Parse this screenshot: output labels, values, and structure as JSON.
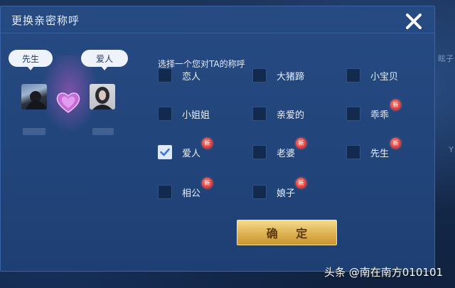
{
  "dialog": {
    "title": "更换亲密称呼",
    "prompt": "选择一个您对TA的称呼",
    "confirm_label": "确 定"
  },
  "pair": {
    "left_bubble": "先生",
    "right_bubble": "爱人"
  },
  "options": [
    {
      "label": "恋人",
      "checked": false,
      "is_new": false
    },
    {
      "label": "大猪蹄",
      "checked": false,
      "is_new": false
    },
    {
      "label": "小宝贝",
      "checked": false,
      "is_new": false
    },
    {
      "label": "小姐姐",
      "checked": false,
      "is_new": false
    },
    {
      "label": "亲爱的",
      "checked": false,
      "is_new": false
    },
    {
      "label": "乖乖",
      "checked": false,
      "is_new": true
    },
    {
      "label": "爱人",
      "checked": true,
      "is_new": true
    },
    {
      "label": "老婆",
      "checked": false,
      "is_new": true
    },
    {
      "label": "先生",
      "checked": false,
      "is_new": true
    },
    {
      "label": "相公",
      "checked": false,
      "is_new": true
    },
    {
      "label": "娘子",
      "checked": false,
      "is_new": true
    }
  ],
  "new_badge_text": "新",
  "background": {
    "edge_text_1": "眩子",
    "edge_text_2": "Y"
  },
  "watermark": "头条 @南在南方010101",
  "colors": {
    "dialog_bg": "#21447a",
    "confirm_gold": "#e2b85a",
    "new_badge": "#e0393a"
  }
}
